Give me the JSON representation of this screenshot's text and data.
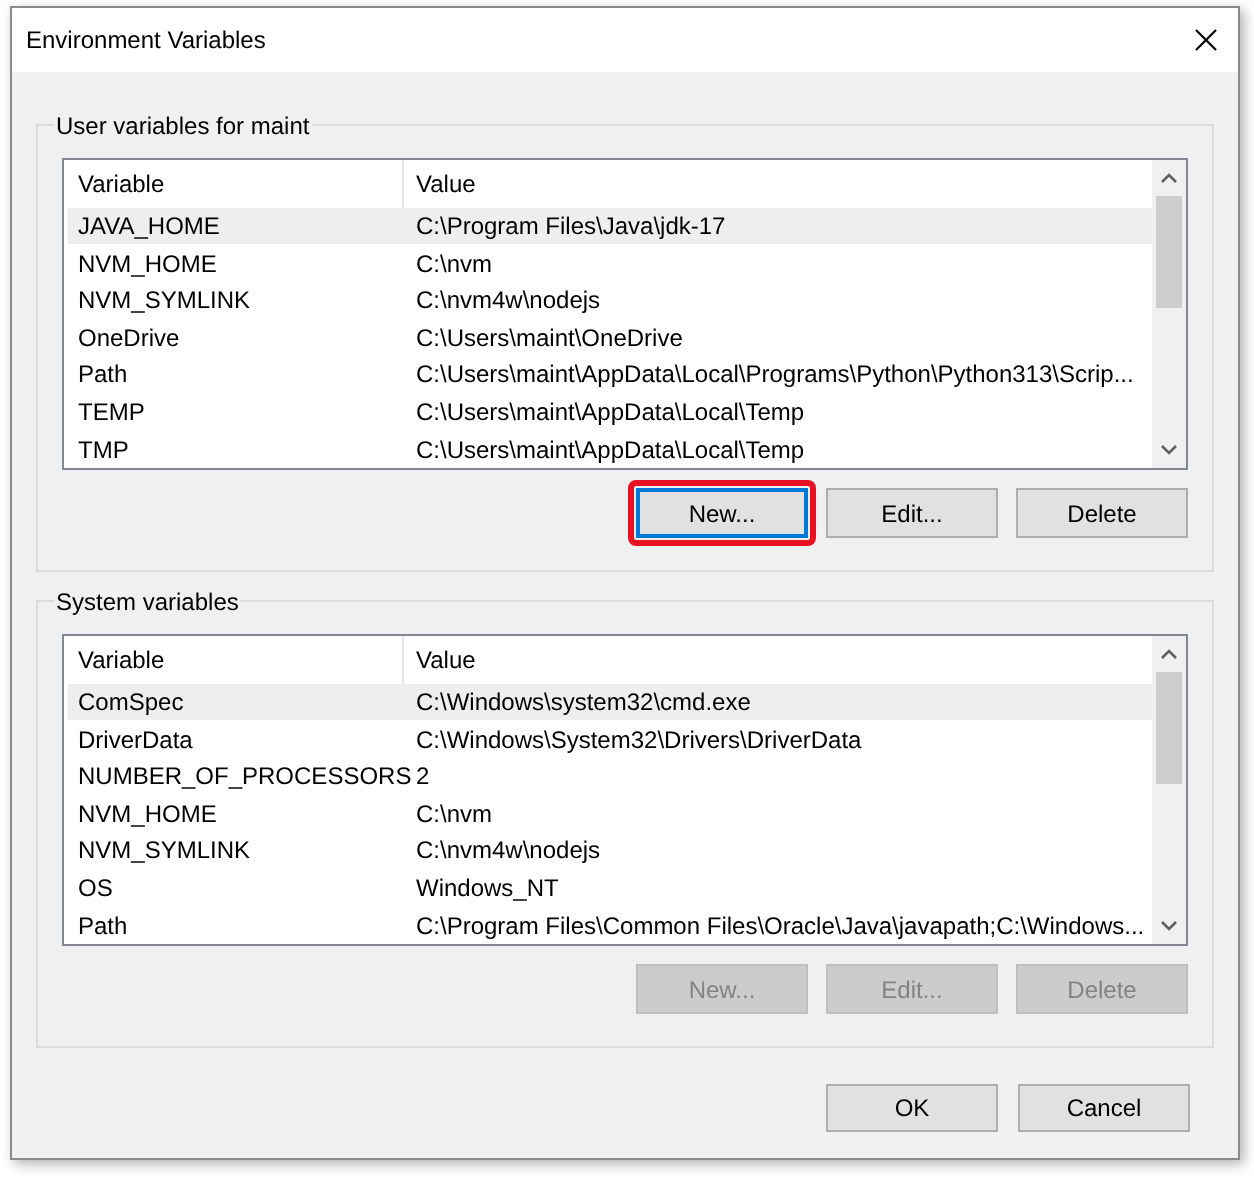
{
  "window": {
    "title": "Environment Variables"
  },
  "groups": [
    {
      "title": "User variables for maint",
      "columns": [
        "Variable",
        "Value"
      ],
      "rows": [
        {
          "variable": "JAVA_HOME",
          "value": "C:\\Program Files\\Java\\jdk-17",
          "selected": true
        },
        {
          "variable": "NVM_HOME",
          "value": "C:\\nvm",
          "selected": false
        },
        {
          "variable": "NVM_SYMLINK",
          "value": "C:\\nvm4w\\nodejs",
          "selected": false
        },
        {
          "variable": "OneDrive",
          "value": "C:\\Users\\maint\\OneDrive",
          "selected": false
        },
        {
          "variable": "Path",
          "value": "C:\\Users\\maint\\AppData\\Local\\Programs\\Python\\Python313\\Scrip...",
          "selected": false
        },
        {
          "variable": "TEMP",
          "value": "C:\\Users\\maint\\AppData\\Local\\Temp",
          "selected": false
        },
        {
          "variable": "TMP",
          "value": "C:\\Users\\maint\\AppData\\Local\\Temp",
          "selected": false
        }
      ],
      "buttons": [
        {
          "label": "New...",
          "disabled": false,
          "highlighted": true
        },
        {
          "label": "Edit...",
          "disabled": false,
          "highlighted": false
        },
        {
          "label": "Delete",
          "disabled": false,
          "highlighted": false
        }
      ]
    },
    {
      "title": "System variables",
      "columns": [
        "Variable",
        "Value"
      ],
      "rows": [
        {
          "variable": "ComSpec",
          "value": "C:\\Windows\\system32\\cmd.exe",
          "selected": true
        },
        {
          "variable": "DriverData",
          "value": "C:\\Windows\\System32\\Drivers\\DriverData",
          "selected": false
        },
        {
          "variable": "NUMBER_OF_PROCESSORS",
          "value": "2",
          "selected": false
        },
        {
          "variable": "NVM_HOME",
          "value": "C:\\nvm",
          "selected": false
        },
        {
          "variable": "NVM_SYMLINK",
          "value": "C:\\nvm4w\\nodejs",
          "selected": false
        },
        {
          "variable": "OS",
          "value": "Windows_NT",
          "selected": false
        },
        {
          "variable": "Path",
          "value": "C:\\Program Files\\Common Files\\Oracle\\Java\\javapath;C:\\Windows...",
          "selected": false
        }
      ],
      "buttons": [
        {
          "label": "New...",
          "disabled": true,
          "highlighted": false
        },
        {
          "label": "Edit...",
          "disabled": true,
          "highlighted": false
        },
        {
          "label": "Delete",
          "disabled": true,
          "highlighted": false
        }
      ]
    }
  ],
  "footer_buttons": [
    {
      "label": "OK"
    },
    {
      "label": "Cancel"
    }
  ]
}
